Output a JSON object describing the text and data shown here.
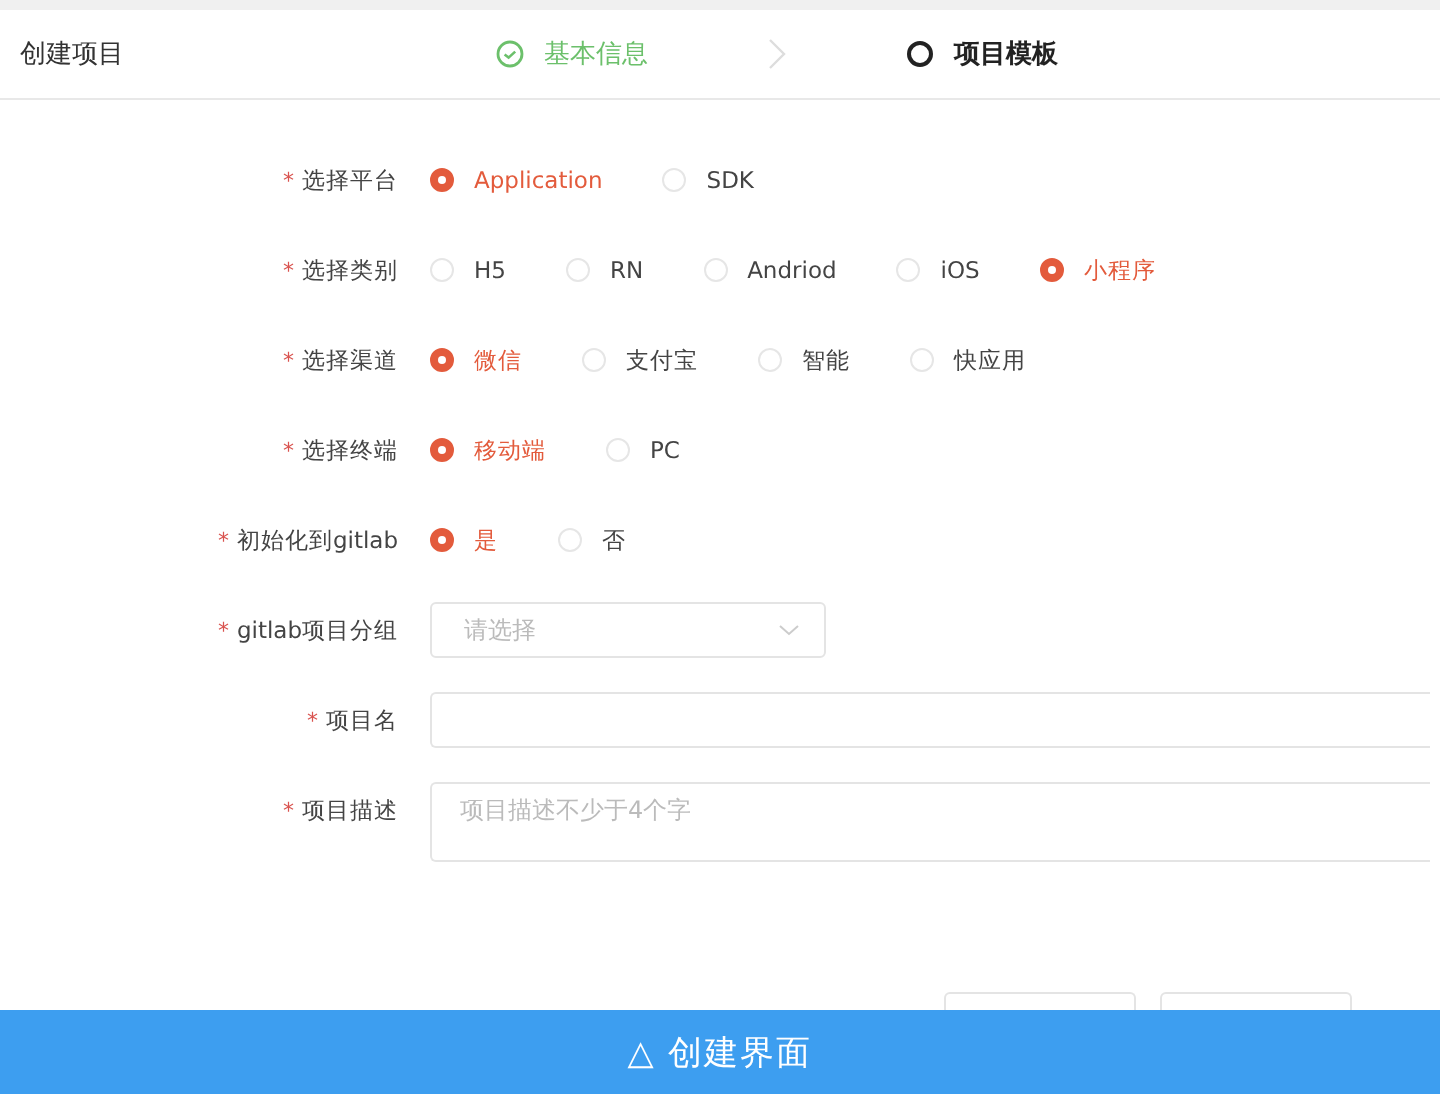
{
  "header": {
    "title": "创建项目",
    "steps": [
      {
        "label": "基本信息",
        "done": true
      },
      {
        "label": "项目模板",
        "done": false
      }
    ]
  },
  "form": {
    "fields": [
      {
        "kind": "radio",
        "mark": "*",
        "label": "选择平台",
        "options": [
          {
            "label": "Application",
            "selected": true
          },
          {
            "label": "SDK",
            "selected": false
          }
        ]
      },
      {
        "kind": "radio",
        "mark": "*",
        "label": "选择类别",
        "options": [
          {
            "label": "H5",
            "selected": false
          },
          {
            "label": "RN",
            "selected": false
          },
          {
            "label": "Andriod",
            "selected": false
          },
          {
            "label": "iOS",
            "selected": false
          },
          {
            "label": "小程序",
            "selected": true
          }
        ]
      },
      {
        "kind": "radio",
        "mark": "*",
        "label": "选择渠道",
        "options": [
          {
            "label": "微信",
            "selected": true
          },
          {
            "label": "支付宝",
            "selected": false
          },
          {
            "label": "智能",
            "selected": false
          },
          {
            "label": "快应用",
            "selected": false
          }
        ]
      },
      {
        "kind": "radio",
        "mark": "*",
        "label": "选择终端",
        "options": [
          {
            "label": "移动端",
            "selected": true
          },
          {
            "label": "PC",
            "selected": false
          }
        ]
      },
      {
        "kind": "radio",
        "mark": "*",
        "label": "初始化到gitlab",
        "options": [
          {
            "label": "是",
            "selected": true
          },
          {
            "label": "否",
            "selected": false
          }
        ]
      },
      {
        "kind": "select",
        "mark": "*",
        "label": "gitlab项目分组",
        "placeholder": "请选择"
      },
      {
        "kind": "input",
        "mark": "*",
        "label": "项目名"
      },
      {
        "kind": "textarea",
        "mark": "*",
        "label": "项目描述",
        "placeholder": "项目描述不少于4个字"
      }
    ]
  },
  "caption": "△ 创建界面"
}
